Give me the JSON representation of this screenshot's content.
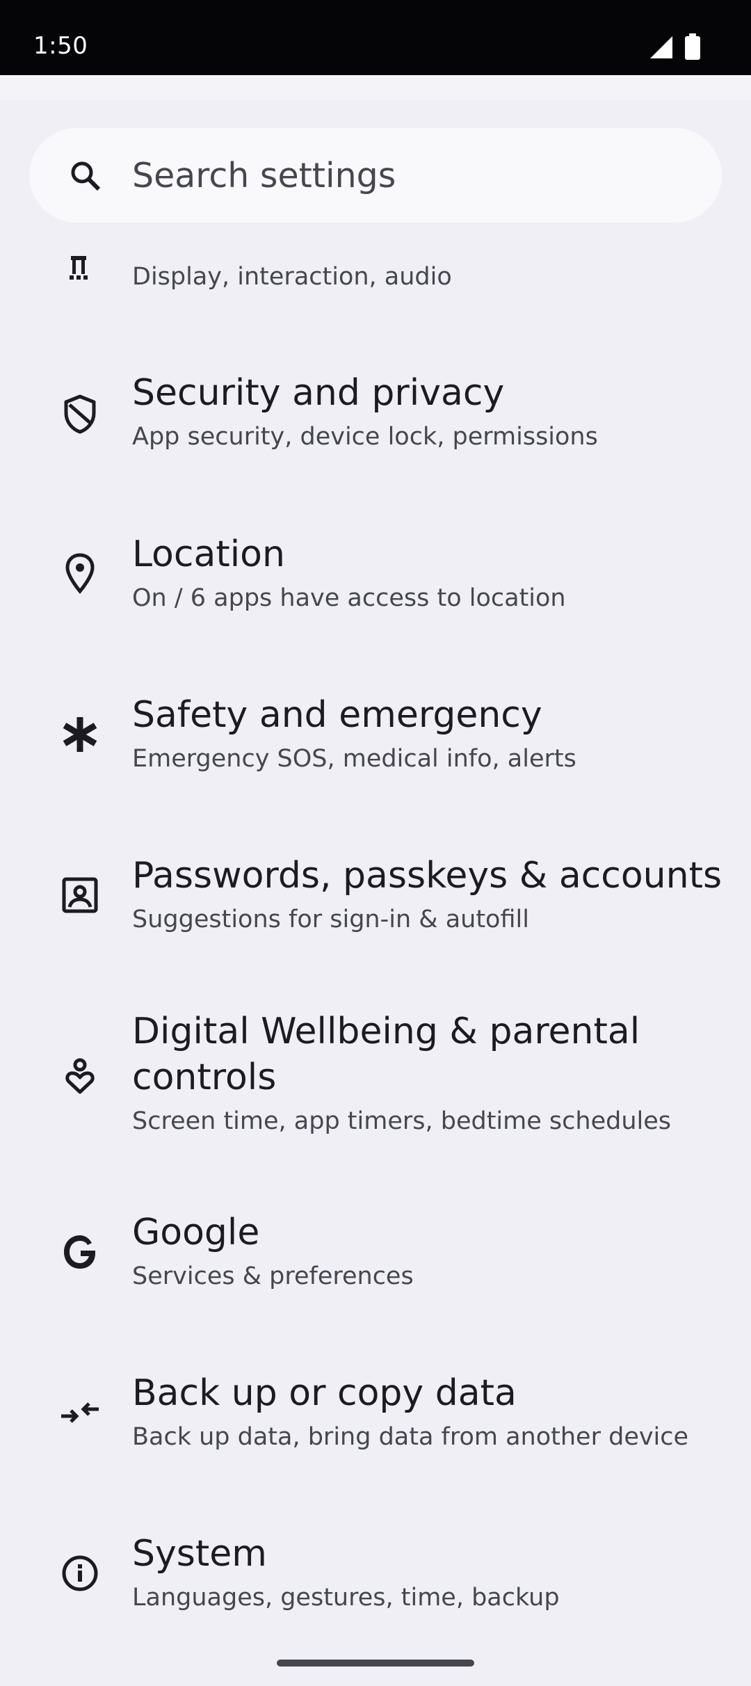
{
  "status_bar": {
    "time": "1:50",
    "signal_icon": "cell-signal-icon",
    "battery_icon": "battery-full-icon"
  },
  "search": {
    "placeholder": "Search settings",
    "icon": "search-icon"
  },
  "settings": {
    "items": [
      {
        "title": "",
        "subtitle": "Display, interaction, audio",
        "icon": "accessibility-icon"
      },
      {
        "title": "Security and privacy",
        "subtitle": "App security, device lock, permissions",
        "icon": "shield-icon"
      },
      {
        "title": "Location",
        "subtitle": "On / 6 apps have access to location",
        "icon": "location-pin-icon"
      },
      {
        "title": "Safety and emergency",
        "subtitle": "Emergency SOS, medical info, alerts",
        "icon": "asterisk-icon"
      },
      {
        "title": "Passwords, passkeys & accounts",
        "subtitle": "Suggestions for sign-in & autofill",
        "icon": "account-box-icon"
      },
      {
        "title_line1": "Digital Wellbeing & parental",
        "title_line2": "controls",
        "subtitle": "Screen time, app timers, bedtime schedules",
        "icon": "wellbeing-icon"
      },
      {
        "title": "Google",
        "subtitle": "Services & preferences",
        "icon": "google-icon"
      },
      {
        "title": "Back up or copy data",
        "subtitle": "Back up data, bring data from another device",
        "icon": "backup-arrows-icon"
      },
      {
        "title": "System",
        "subtitle": "Languages, gestures, time, backup",
        "icon": "info-icon"
      }
    ]
  },
  "colors": {
    "background": "#efeff5",
    "status_bar": "#050507",
    "search_bar": "#f9f9fc",
    "title_text": "#1b1b21",
    "subtitle_text": "#46464f"
  }
}
